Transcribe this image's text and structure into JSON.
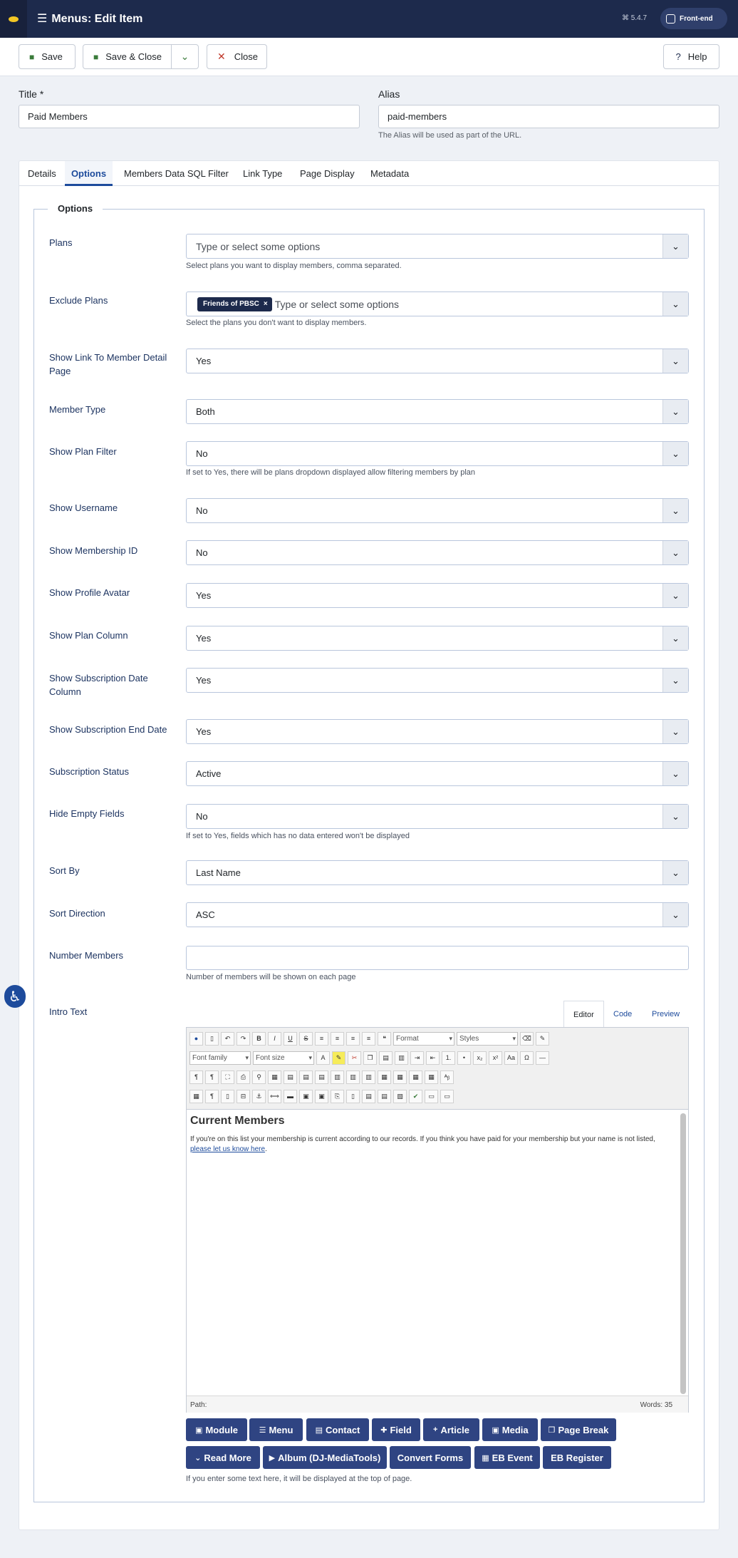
{
  "header": {
    "title": "Menus: Edit Item",
    "version": "⌘ 5.4.7",
    "frontend_label": "Front-end"
  },
  "toolbar": {
    "save": "Save",
    "save_close": "Save & Close",
    "close": "Close",
    "help": "Help"
  },
  "form": {
    "title_label": "Title *",
    "title_value": "Paid Members",
    "alias_label": "Alias",
    "alias_value": "paid-members",
    "alias_hint": "The Alias will be used as part of the URL."
  },
  "tabs": [
    "Details",
    "Options",
    "Members Data SQL Filter",
    "Link Type",
    "Page Display",
    "Metadata"
  ],
  "options": {
    "legend": "Options",
    "plans": {
      "label": "Plans",
      "placeholder": "Type or select some options",
      "hint": "Select plans you want to display members, comma separated."
    },
    "exclude_plans": {
      "label": "Exclude Plans",
      "chip": "Friends of PBSC",
      "placeholder": "Type or select some options",
      "hint": "Select the plans you don't want to display members."
    },
    "show_link": {
      "label": "Show Link To Member Detail Page",
      "value": "Yes"
    },
    "member_type": {
      "label": "Member Type",
      "value": "Both"
    },
    "show_plan_filter": {
      "label": "Show Plan Filter",
      "value": "No",
      "hint": "If set to Yes, there will be plans dropdown displayed allow filtering members by plan"
    },
    "show_username": {
      "label": "Show Username",
      "value": "No"
    },
    "show_membership_id": {
      "label": "Show Membership ID",
      "value": "No"
    },
    "show_profile_avatar": {
      "label": "Show Profile Avatar",
      "value": "Yes"
    },
    "show_plan_column": {
      "label": "Show Plan Column",
      "value": "Yes"
    },
    "show_sub_date": {
      "label": "Show Subscription Date Column",
      "value": "Yes"
    },
    "show_sub_end": {
      "label": "Show Subscription End Date",
      "value": "Yes"
    },
    "sub_status": {
      "label": "Subscription Status",
      "value": "Active"
    },
    "hide_empty": {
      "label": "Hide Empty Fields",
      "value": "No",
      "hint": "If set to Yes, fields which has no data entered won't be displayed"
    },
    "sort_by": {
      "label": "Sort By",
      "value": "Last Name"
    },
    "sort_direction": {
      "label": "Sort Direction",
      "value": "ASC"
    },
    "number_members": {
      "label": "Number Members",
      "value": "",
      "hint": "Number of members will be shown on each page"
    },
    "intro_text": {
      "label": "Intro Text",
      "hint": "If you enter some text here, it will be displayed at the top of page."
    }
  },
  "editor": {
    "tabs": [
      "Editor",
      "Code",
      "Preview"
    ],
    "format": "Format",
    "styles": "Styles",
    "font_family": "Font family",
    "font_size": "Font size",
    "heading": "Current Members",
    "body": "If you're on this list your membership is current according to our records. If you think you have paid for your membership but your name is not listed, ",
    "link": "please let us know here",
    "after_link": ".",
    "path": "Path:",
    "words": "Words:  35"
  },
  "xtd_buttons": [
    "Module",
    "Menu",
    "Contact",
    "Field",
    "Article",
    "Media",
    "Page Break",
    "Read More",
    "Album (DJ-MediaTools)",
    "Convert Forms",
    "EB Event",
    "EB Register"
  ]
}
